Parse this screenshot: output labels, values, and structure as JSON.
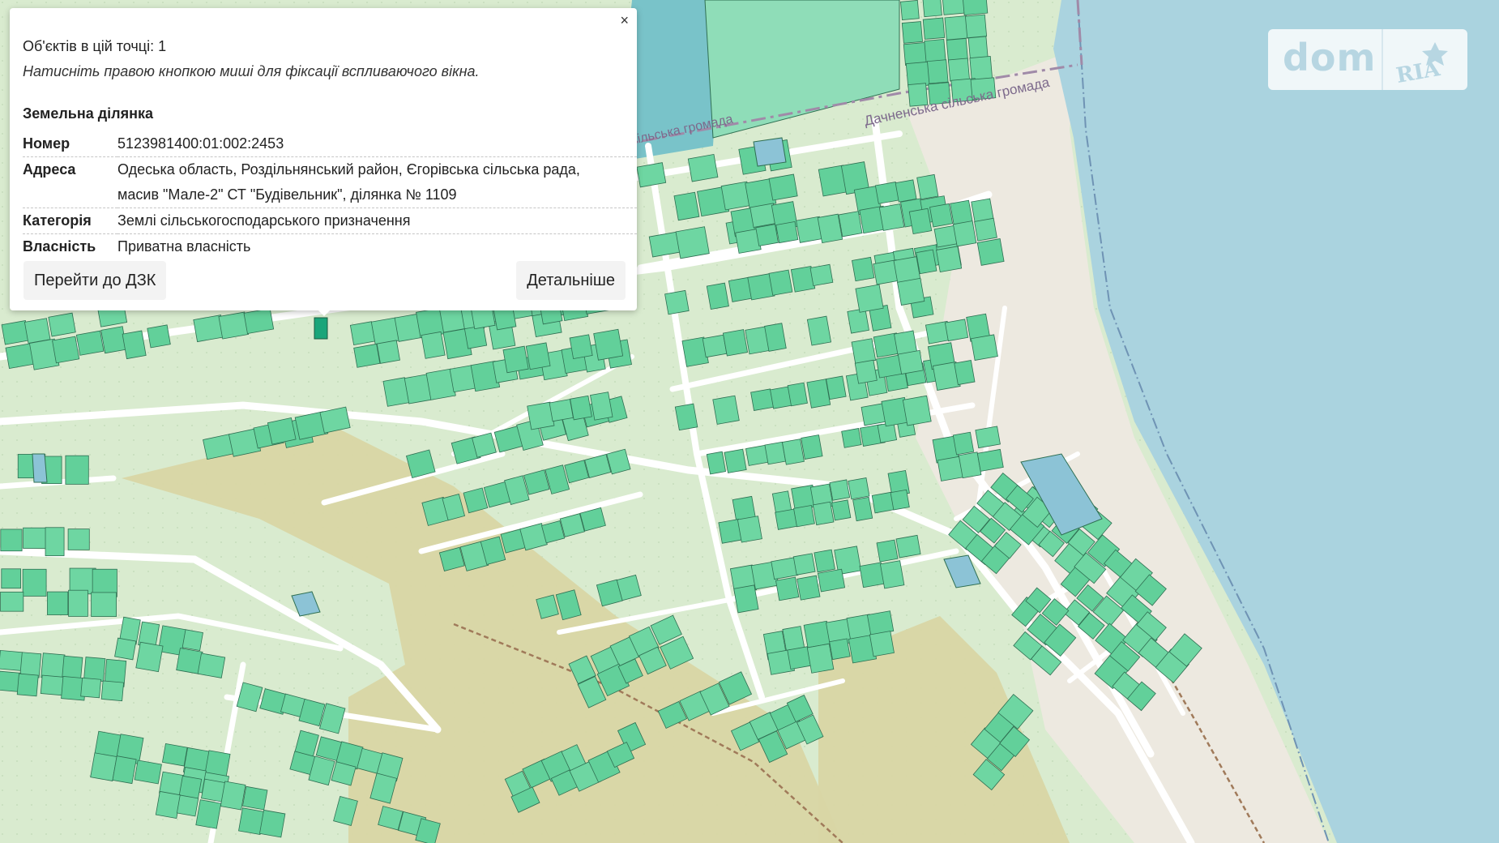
{
  "popup": {
    "objects_count": "Об'єктів в цій точці: 1",
    "hint": "Натисніть правою кнопкою миші для фіксації вспливаючого вікна.",
    "close_symbol": "×",
    "section_title": "Земельна ділянка",
    "rows": [
      {
        "label": "Номер",
        "value": "5123981400:01:002:2453"
      },
      {
        "label": "Адреса",
        "value_lines": [
          "Одеська область, Роздільнянський район, Єгорівська сільська рада,",
          "масив \"Мале-2\" СТ \"Будівельник\", ділянка № 1109"
        ]
      },
      {
        "label": "Категорія",
        "value": "Землі сільськогосподарського призначення"
      },
      {
        "label": "Власність",
        "value": "Приватна власність"
      }
    ],
    "buttons": {
      "dzk": "Перейти до ДЗК",
      "details": "Детальніше"
    }
  },
  "map": {
    "labels": {
      "community_right": "Дачненська сільська громада",
      "community_left": "сільська громада"
    },
    "colors": {
      "background": "#d9ebcf",
      "water": "#aad3df",
      "beach": "#ede9e0",
      "parcel_fill": "#62d09a",
      "parcel_stroke": "#2f6f52",
      "farmland": "#d9d6a4",
      "road": "#ffffff",
      "boundary": "#9b86a6",
      "special_parcel": "#8cc3d6"
    }
  },
  "logo": {
    "brand": "dom",
    "sub_brand": "RIA",
    "colors": {
      "dom": "#b7d6e2",
      "ria": "#b7d6e2"
    }
  }
}
